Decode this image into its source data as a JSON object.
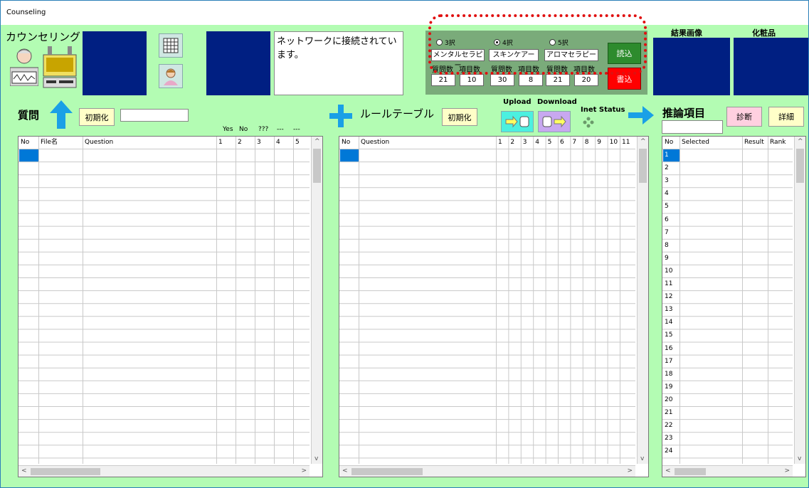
{
  "window": {
    "title": "Counseling"
  },
  "app": {
    "name": "カウンセリング"
  },
  "status": {
    "message": "ネットワークに接続されています。"
  },
  "settings": {
    "options": [
      {
        "label": "3択",
        "selected": false
      },
      {
        "label": "4択",
        "selected": true
      },
      {
        "label": "5択",
        "selected": false
      }
    ],
    "categories": [
      "メンタルセラピー",
      "スキンケアー",
      "アロマセラピー"
    ],
    "labels": {
      "q_count": "質問数",
      "item_count": "項目数"
    },
    "counts": [
      {
        "questions": "21",
        "items": "10"
      },
      {
        "questions": "30",
        "items": "8"
      },
      {
        "questions": "21",
        "items": "20"
      }
    ],
    "read_label": "読込",
    "write_label": "書込"
  },
  "header_labels": {
    "result_image": "結果画像",
    "cosmetics": "化粧品"
  },
  "question": {
    "title": "質問",
    "init_label": "初期化",
    "answer_headers": [
      "Yes",
      "No",
      "???",
      "---",
      "---"
    ],
    "columns": [
      "No",
      "File名",
      "Question",
      "1",
      "2",
      "3",
      "4",
      "5"
    ]
  },
  "rule": {
    "title": "ルールテーブル",
    "init_label": "初期化",
    "upload_label": "Upload",
    "download_label": "Download",
    "inet_status_label": "Inet Status",
    "columns": [
      "No",
      "Question",
      "1",
      "2",
      "3",
      "4",
      "5",
      "6",
      "7",
      "8",
      "9",
      "10",
      "11"
    ]
  },
  "inference": {
    "title": "推論項目",
    "diagnose_label": "診断",
    "detail_label": "詳細",
    "columns": [
      "No",
      "Selected",
      "Result",
      "Rank"
    ],
    "row_numbers": [
      "1",
      "2",
      "3",
      "4",
      "5",
      "6",
      "7",
      "8",
      "9",
      "10",
      "11",
      "12",
      "13",
      "14",
      "15",
      "16",
      "17",
      "18",
      "19",
      "20",
      "21",
      "22",
      "23",
      "24"
    ]
  },
  "colors": {
    "background": "#b3fcb3",
    "navy": "#001f82",
    "read_button": "#2d8b2d",
    "write_button": "#ff0000",
    "arrow_blue": "#1aa0e6",
    "annotation": "#e01010"
  },
  "icons": [
    "counselor-icon",
    "machine-icon",
    "grid-icon",
    "person-icon",
    "arrow-up-icon",
    "plus-icon",
    "arrow-right-icon",
    "upload-icon",
    "download-icon",
    "inet-status-icon"
  ]
}
